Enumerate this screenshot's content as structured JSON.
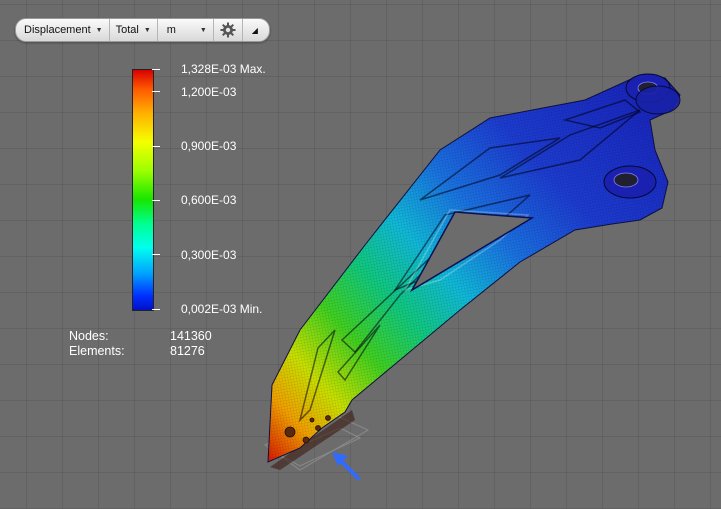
{
  "toolbar": {
    "result_type": "Displacement",
    "component": "Total",
    "unit": "m"
  },
  "legend": {
    "labels": [
      "1,328E-03 Max.",
      "1,200E-03",
      "0,900E-03",
      "0,600E-03",
      "0,300E-03",
      "0,002E-03 Min."
    ]
  },
  "stats": {
    "nodes_label": "Nodes:",
    "nodes_value": "141360",
    "elements_label": "Elements:",
    "elements_value": "81276"
  },
  "colors": {
    "max": "#d80000",
    "mid": "#18e600",
    "min": "#0010c8",
    "load_arrow": "#2f6bff"
  },
  "icons": [
    "gear-icon",
    "collapse-icon",
    "chevron-down-icon",
    "load-arrow-icon"
  ]
}
